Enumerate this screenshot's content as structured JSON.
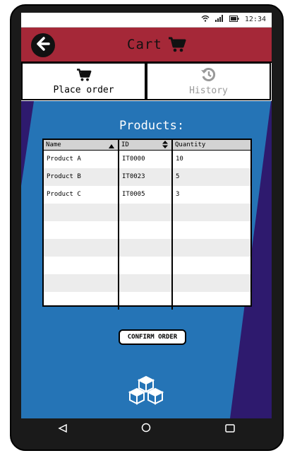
{
  "statusbar": {
    "time": "12:34"
  },
  "header": {
    "title": "Cart"
  },
  "tabs": [
    {
      "label": "Place order"
    },
    {
      "label": "History"
    }
  ],
  "products": {
    "title": "Products:",
    "columns": [
      "Name",
      "ID",
      "Quantity"
    ],
    "rows": [
      [
        "Product A",
        "IT0000",
        "10"
      ],
      [
        "Product B",
        "IT0023",
        "5"
      ],
      [
        "Product C",
        "IT0005",
        "3"
      ],
      [
        "",
        "",
        ""
      ],
      [
        "",
        "",
        ""
      ],
      [
        "",
        "",
        ""
      ],
      [
        "",
        "",
        ""
      ],
      [
        "",
        "",
        ""
      ],
      [
        "",
        "",
        ""
      ]
    ]
  },
  "confirm_label": "CONFIRM ORDER",
  "colors": {
    "header": "#a52838",
    "panel": "#2574b6",
    "background": "#2e1a6e"
  },
  "icons": [
    "back-icon",
    "cart-icon",
    "history-icon",
    "wifi-icon",
    "signal-icon",
    "battery-icon",
    "app-logo-icon"
  ]
}
